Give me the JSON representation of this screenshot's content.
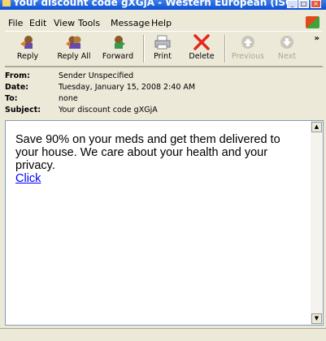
{
  "window": {
    "title": "Your discount code gXGjA - Western European (ISO)",
    "minimize_glyph": "_",
    "maximize_glyph": "□",
    "close_glyph": "×"
  },
  "menu": {
    "file": "File",
    "edit": "Edit",
    "view": "View",
    "tools": "Tools",
    "message": "Message",
    "help": "Help"
  },
  "toolbar": {
    "reply": "Reply",
    "reply_all": "Reply All",
    "forward": "Forward",
    "print": "Print",
    "delete": "Delete",
    "previous": "Previous",
    "next": "Next",
    "more": "»"
  },
  "header": {
    "from_label": "From:",
    "from_value": "Sender Unspecified",
    "date_label": "Date:",
    "date_value": "Tuesday, January 15, 2008 2:40 AM",
    "to_label": "To:",
    "to_value": "none",
    "subject_label": "Subject:",
    "subject_value": "Your discount code gXGjA"
  },
  "message": {
    "body": "Save 90% on your meds and get them delivered to your house. We care about your health and your privacy.",
    "link": "Click"
  },
  "colors": {
    "delete_red": "#e3291c",
    "disabled_gray": "#aca899",
    "link_blue": "#0000ff"
  }
}
